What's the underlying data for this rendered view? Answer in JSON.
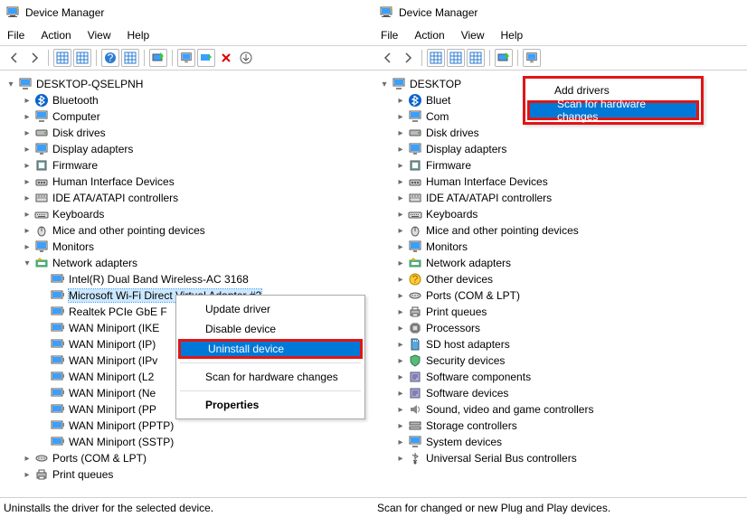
{
  "window_title": "Device Manager",
  "menus": {
    "file": "File",
    "action": "Action",
    "view": "View",
    "help": "Help"
  },
  "left": {
    "root": "DESKTOP-QSELPNH",
    "categories": [
      "Bluetooth",
      "Computer",
      "Disk drives",
      "Display adapters",
      "Firmware",
      "Human Interface Devices",
      "IDE ATA/ATAPI controllers",
      "Keyboards",
      "Mice and other pointing devices",
      "Monitors",
      "Network adapters",
      "Ports (COM & LPT)",
      "Print queues"
    ],
    "net_children": [
      "Intel(R) Dual Band Wireless-AC 3168",
      "Microsoft Wi-Fi Direct Virtual Adapter #2",
      "Realtek PCIe GbE F",
      "WAN Miniport (IKE",
      "WAN Miniport (IP)",
      "WAN Miniport (IPv",
      "WAN Miniport (L2",
      "WAN Miniport (Ne",
      "WAN Miniport (PP",
      "WAN Miniport (PPTP)",
      "WAN Miniport (SSTP)"
    ],
    "ctx": {
      "update": "Update driver",
      "disable": "Disable device",
      "uninstall": "Uninstall device",
      "scan": "Scan for hardware changes",
      "props": "Properties"
    },
    "status": "Uninstalls the driver for the selected device."
  },
  "right": {
    "root_vis": "DESKTOP",
    "categories": [
      "Bluet",
      "Com",
      "Disk drives",
      "Display adapters",
      "Firmware",
      "Human Interface Devices",
      "IDE ATA/ATAPI controllers",
      "Keyboards",
      "Mice and other pointing devices",
      "Monitors",
      "Network adapters",
      "Other devices",
      "Ports (COM & LPT)",
      "Print queues",
      "Processors",
      "SD host adapters",
      "Security devices",
      "Software components",
      "Software devices",
      "Sound, video and game controllers",
      "Storage controllers",
      "System devices",
      "Universal Serial Bus controllers"
    ],
    "ctx": {
      "add": "Add drivers",
      "scan": "Scan for hardware changes"
    },
    "status": "Scan for changed or new Plug and Play devices."
  }
}
